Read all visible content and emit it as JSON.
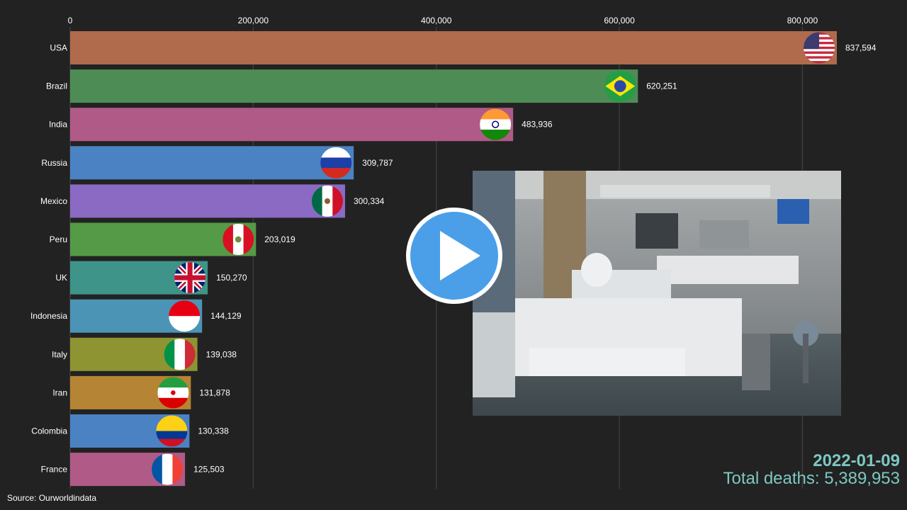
{
  "chart_data": {
    "type": "bar",
    "orientation": "horizontal",
    "categories": [
      "USA",
      "Brazil",
      "India",
      "Russia",
      "Mexico",
      "Peru",
      "UK",
      "Indonesia",
      "Italy",
      "Iran",
      "Colombia",
      "France"
    ],
    "values": [
      837594,
      620251,
      483936,
      309787,
      300334,
      203019,
      150270,
      144129,
      139038,
      131878,
      130338,
      125503
    ],
    "value_labels": [
      "837,594",
      "620,251",
      "483,936",
      "309,787",
      "300,334",
      "203,019",
      "150,270",
      "144,129",
      "139,038",
      "131,878",
      "130,338",
      "125,503"
    ],
    "colors": [
      "#b06a4c",
      "#4e8c55",
      "#b05a87",
      "#4b82c3",
      "#8a6ac3",
      "#559a46",
      "#3e9488",
      "#4b94b6",
      "#8e9432",
      "#b58434",
      "#4b82c3",
      "#b05a87"
    ],
    "flags": [
      "usa-flag-icon",
      "brazil-flag-icon",
      "india-flag-icon",
      "russia-flag-icon",
      "mexico-flag-icon",
      "peru-flag-icon",
      "uk-flag-icon",
      "indonesia-flag-icon",
      "italy-flag-icon",
      "iran-flag-icon",
      "colombia-flag-icon",
      "france-flag-icon"
    ],
    "x_ticks": [
      0,
      200000,
      400000,
      600000,
      800000
    ],
    "x_tick_labels": [
      "0",
      "200,000",
      "400,000",
      "600,000",
      "800,000"
    ],
    "xlim": [
      0,
      837594
    ],
    "grid": true,
    "axis_position": "top"
  },
  "date": "2022-01-09",
  "total_deaths": "Total deaths: 5,389,953",
  "source": "Source: Ourworldindata",
  "video": {
    "thumbnail": "hospital-ward-photo",
    "play_icon": "play-icon"
  },
  "theme": {
    "background": "#222222",
    "accent": "#7ec8c2",
    "play_blue": "#4a9fe8"
  }
}
